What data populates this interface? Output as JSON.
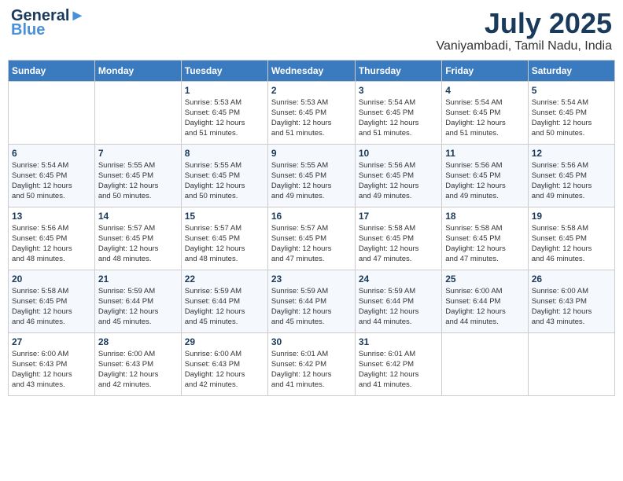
{
  "header": {
    "logo_line1": "General",
    "logo_line2": "Blue",
    "month": "July 2025",
    "location": "Vaniyambadi, Tamil Nadu, India"
  },
  "days_of_week": [
    "Sunday",
    "Monday",
    "Tuesday",
    "Wednesday",
    "Thursday",
    "Friday",
    "Saturday"
  ],
  "weeks": [
    [
      {
        "day": "",
        "detail": ""
      },
      {
        "day": "",
        "detail": ""
      },
      {
        "day": "1",
        "detail": "Sunrise: 5:53 AM\nSunset: 6:45 PM\nDaylight: 12 hours\nand 51 minutes."
      },
      {
        "day": "2",
        "detail": "Sunrise: 5:53 AM\nSunset: 6:45 PM\nDaylight: 12 hours\nand 51 minutes."
      },
      {
        "day": "3",
        "detail": "Sunrise: 5:54 AM\nSunset: 6:45 PM\nDaylight: 12 hours\nand 51 minutes."
      },
      {
        "day": "4",
        "detail": "Sunrise: 5:54 AM\nSunset: 6:45 PM\nDaylight: 12 hours\nand 51 minutes."
      },
      {
        "day": "5",
        "detail": "Sunrise: 5:54 AM\nSunset: 6:45 PM\nDaylight: 12 hours\nand 50 minutes."
      }
    ],
    [
      {
        "day": "6",
        "detail": "Sunrise: 5:54 AM\nSunset: 6:45 PM\nDaylight: 12 hours\nand 50 minutes."
      },
      {
        "day": "7",
        "detail": "Sunrise: 5:55 AM\nSunset: 6:45 PM\nDaylight: 12 hours\nand 50 minutes."
      },
      {
        "day": "8",
        "detail": "Sunrise: 5:55 AM\nSunset: 6:45 PM\nDaylight: 12 hours\nand 50 minutes."
      },
      {
        "day": "9",
        "detail": "Sunrise: 5:55 AM\nSunset: 6:45 PM\nDaylight: 12 hours\nand 49 minutes."
      },
      {
        "day": "10",
        "detail": "Sunrise: 5:56 AM\nSunset: 6:45 PM\nDaylight: 12 hours\nand 49 minutes."
      },
      {
        "day": "11",
        "detail": "Sunrise: 5:56 AM\nSunset: 6:45 PM\nDaylight: 12 hours\nand 49 minutes."
      },
      {
        "day": "12",
        "detail": "Sunrise: 5:56 AM\nSunset: 6:45 PM\nDaylight: 12 hours\nand 49 minutes."
      }
    ],
    [
      {
        "day": "13",
        "detail": "Sunrise: 5:56 AM\nSunset: 6:45 PM\nDaylight: 12 hours\nand 48 minutes."
      },
      {
        "day": "14",
        "detail": "Sunrise: 5:57 AM\nSunset: 6:45 PM\nDaylight: 12 hours\nand 48 minutes."
      },
      {
        "day": "15",
        "detail": "Sunrise: 5:57 AM\nSunset: 6:45 PM\nDaylight: 12 hours\nand 48 minutes."
      },
      {
        "day": "16",
        "detail": "Sunrise: 5:57 AM\nSunset: 6:45 PM\nDaylight: 12 hours\nand 47 minutes."
      },
      {
        "day": "17",
        "detail": "Sunrise: 5:58 AM\nSunset: 6:45 PM\nDaylight: 12 hours\nand 47 minutes."
      },
      {
        "day": "18",
        "detail": "Sunrise: 5:58 AM\nSunset: 6:45 PM\nDaylight: 12 hours\nand 47 minutes."
      },
      {
        "day": "19",
        "detail": "Sunrise: 5:58 AM\nSunset: 6:45 PM\nDaylight: 12 hours\nand 46 minutes."
      }
    ],
    [
      {
        "day": "20",
        "detail": "Sunrise: 5:58 AM\nSunset: 6:45 PM\nDaylight: 12 hours\nand 46 minutes."
      },
      {
        "day": "21",
        "detail": "Sunrise: 5:59 AM\nSunset: 6:44 PM\nDaylight: 12 hours\nand 45 minutes."
      },
      {
        "day": "22",
        "detail": "Sunrise: 5:59 AM\nSunset: 6:44 PM\nDaylight: 12 hours\nand 45 minutes."
      },
      {
        "day": "23",
        "detail": "Sunrise: 5:59 AM\nSunset: 6:44 PM\nDaylight: 12 hours\nand 45 minutes."
      },
      {
        "day": "24",
        "detail": "Sunrise: 5:59 AM\nSunset: 6:44 PM\nDaylight: 12 hours\nand 44 minutes."
      },
      {
        "day": "25",
        "detail": "Sunrise: 6:00 AM\nSunset: 6:44 PM\nDaylight: 12 hours\nand 44 minutes."
      },
      {
        "day": "26",
        "detail": "Sunrise: 6:00 AM\nSunset: 6:43 PM\nDaylight: 12 hours\nand 43 minutes."
      }
    ],
    [
      {
        "day": "27",
        "detail": "Sunrise: 6:00 AM\nSunset: 6:43 PM\nDaylight: 12 hours\nand 43 minutes."
      },
      {
        "day": "28",
        "detail": "Sunrise: 6:00 AM\nSunset: 6:43 PM\nDaylight: 12 hours\nand 42 minutes."
      },
      {
        "day": "29",
        "detail": "Sunrise: 6:00 AM\nSunset: 6:43 PM\nDaylight: 12 hours\nand 42 minutes."
      },
      {
        "day": "30",
        "detail": "Sunrise: 6:01 AM\nSunset: 6:42 PM\nDaylight: 12 hours\nand 41 minutes."
      },
      {
        "day": "31",
        "detail": "Sunrise: 6:01 AM\nSunset: 6:42 PM\nDaylight: 12 hours\nand 41 minutes."
      },
      {
        "day": "",
        "detail": ""
      },
      {
        "day": "",
        "detail": ""
      }
    ]
  ]
}
